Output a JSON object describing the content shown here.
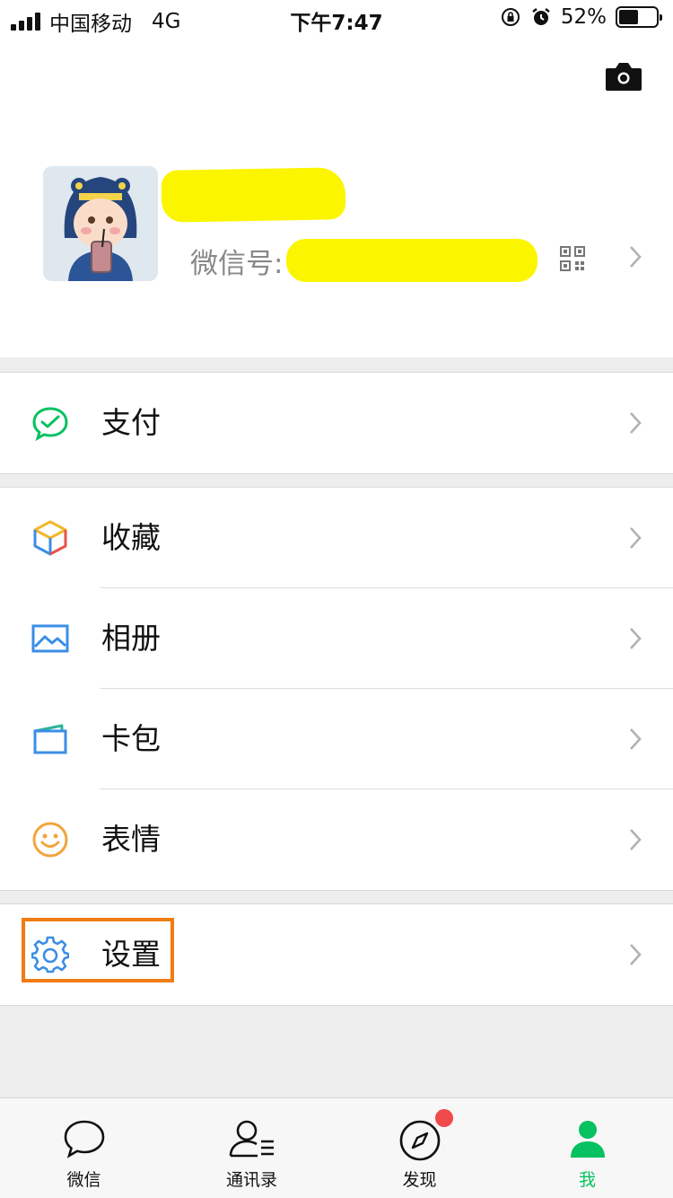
{
  "status_bar": {
    "carrier": "中国移动",
    "network": "4G",
    "time": "下午7:47",
    "battery_percent": "52%",
    "battery_level": 0.52
  },
  "profile": {
    "wechat_id_label": "微信号:"
  },
  "menu": {
    "pay": "支付",
    "favorites": "收藏",
    "album": "相册",
    "cards": "卡包",
    "stickers": "表情",
    "settings": "设置"
  },
  "tabbar": {
    "chats": "微信",
    "contacts": "通讯录",
    "discover": "发现",
    "me": "我"
  },
  "colors": {
    "accent_green": "#07c160",
    "highlight_orange": "#f07c12",
    "redaction_yellow": "#fbf500",
    "badge_red": "#f04a4a"
  }
}
